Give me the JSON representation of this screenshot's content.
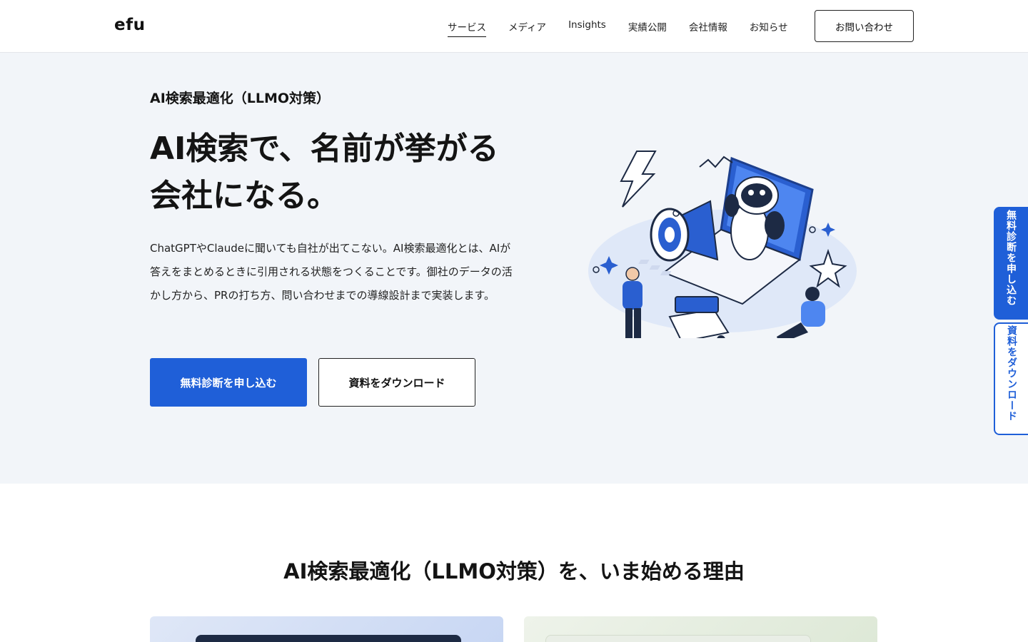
{
  "header": {
    "logo": "efu",
    "nav": [
      {
        "label": "サービス",
        "active": true
      },
      {
        "label": "メディア"
      },
      {
        "label": "Insights"
      },
      {
        "label": "実績公開"
      },
      {
        "label": "会社情報"
      },
      {
        "label": "お知らせ"
      }
    ],
    "contact_label": "お問い合わせ"
  },
  "hero": {
    "eyebrow": "AI検索最適化（LLMO対策）",
    "headline_line1": "AI検索で、名前が挙がる",
    "headline_line2": "会社になる。",
    "lead": "ChatGPTやClaudeに聞いても自社が出てこない。AI検索最適化とは、AIが答えをまとめるときに引用される状態をつくることです。御社のデータの活かし方から、PRの打ち方、問い合わせまでの導線設計まで実装します。",
    "cta_primary": "無料診断を申し込む",
    "cta_secondary": "資料をダウンロード"
  },
  "side_tabs": {
    "primary": "無料診断を申し込む",
    "secondary": "資料をダウンロード"
  },
  "reasons": {
    "title": "AI検索最適化（LLMO対策）を、いま始める理由"
  },
  "colors": {
    "accent": "#1f5fd8",
    "hero_bg": "#f2f5f9"
  }
}
